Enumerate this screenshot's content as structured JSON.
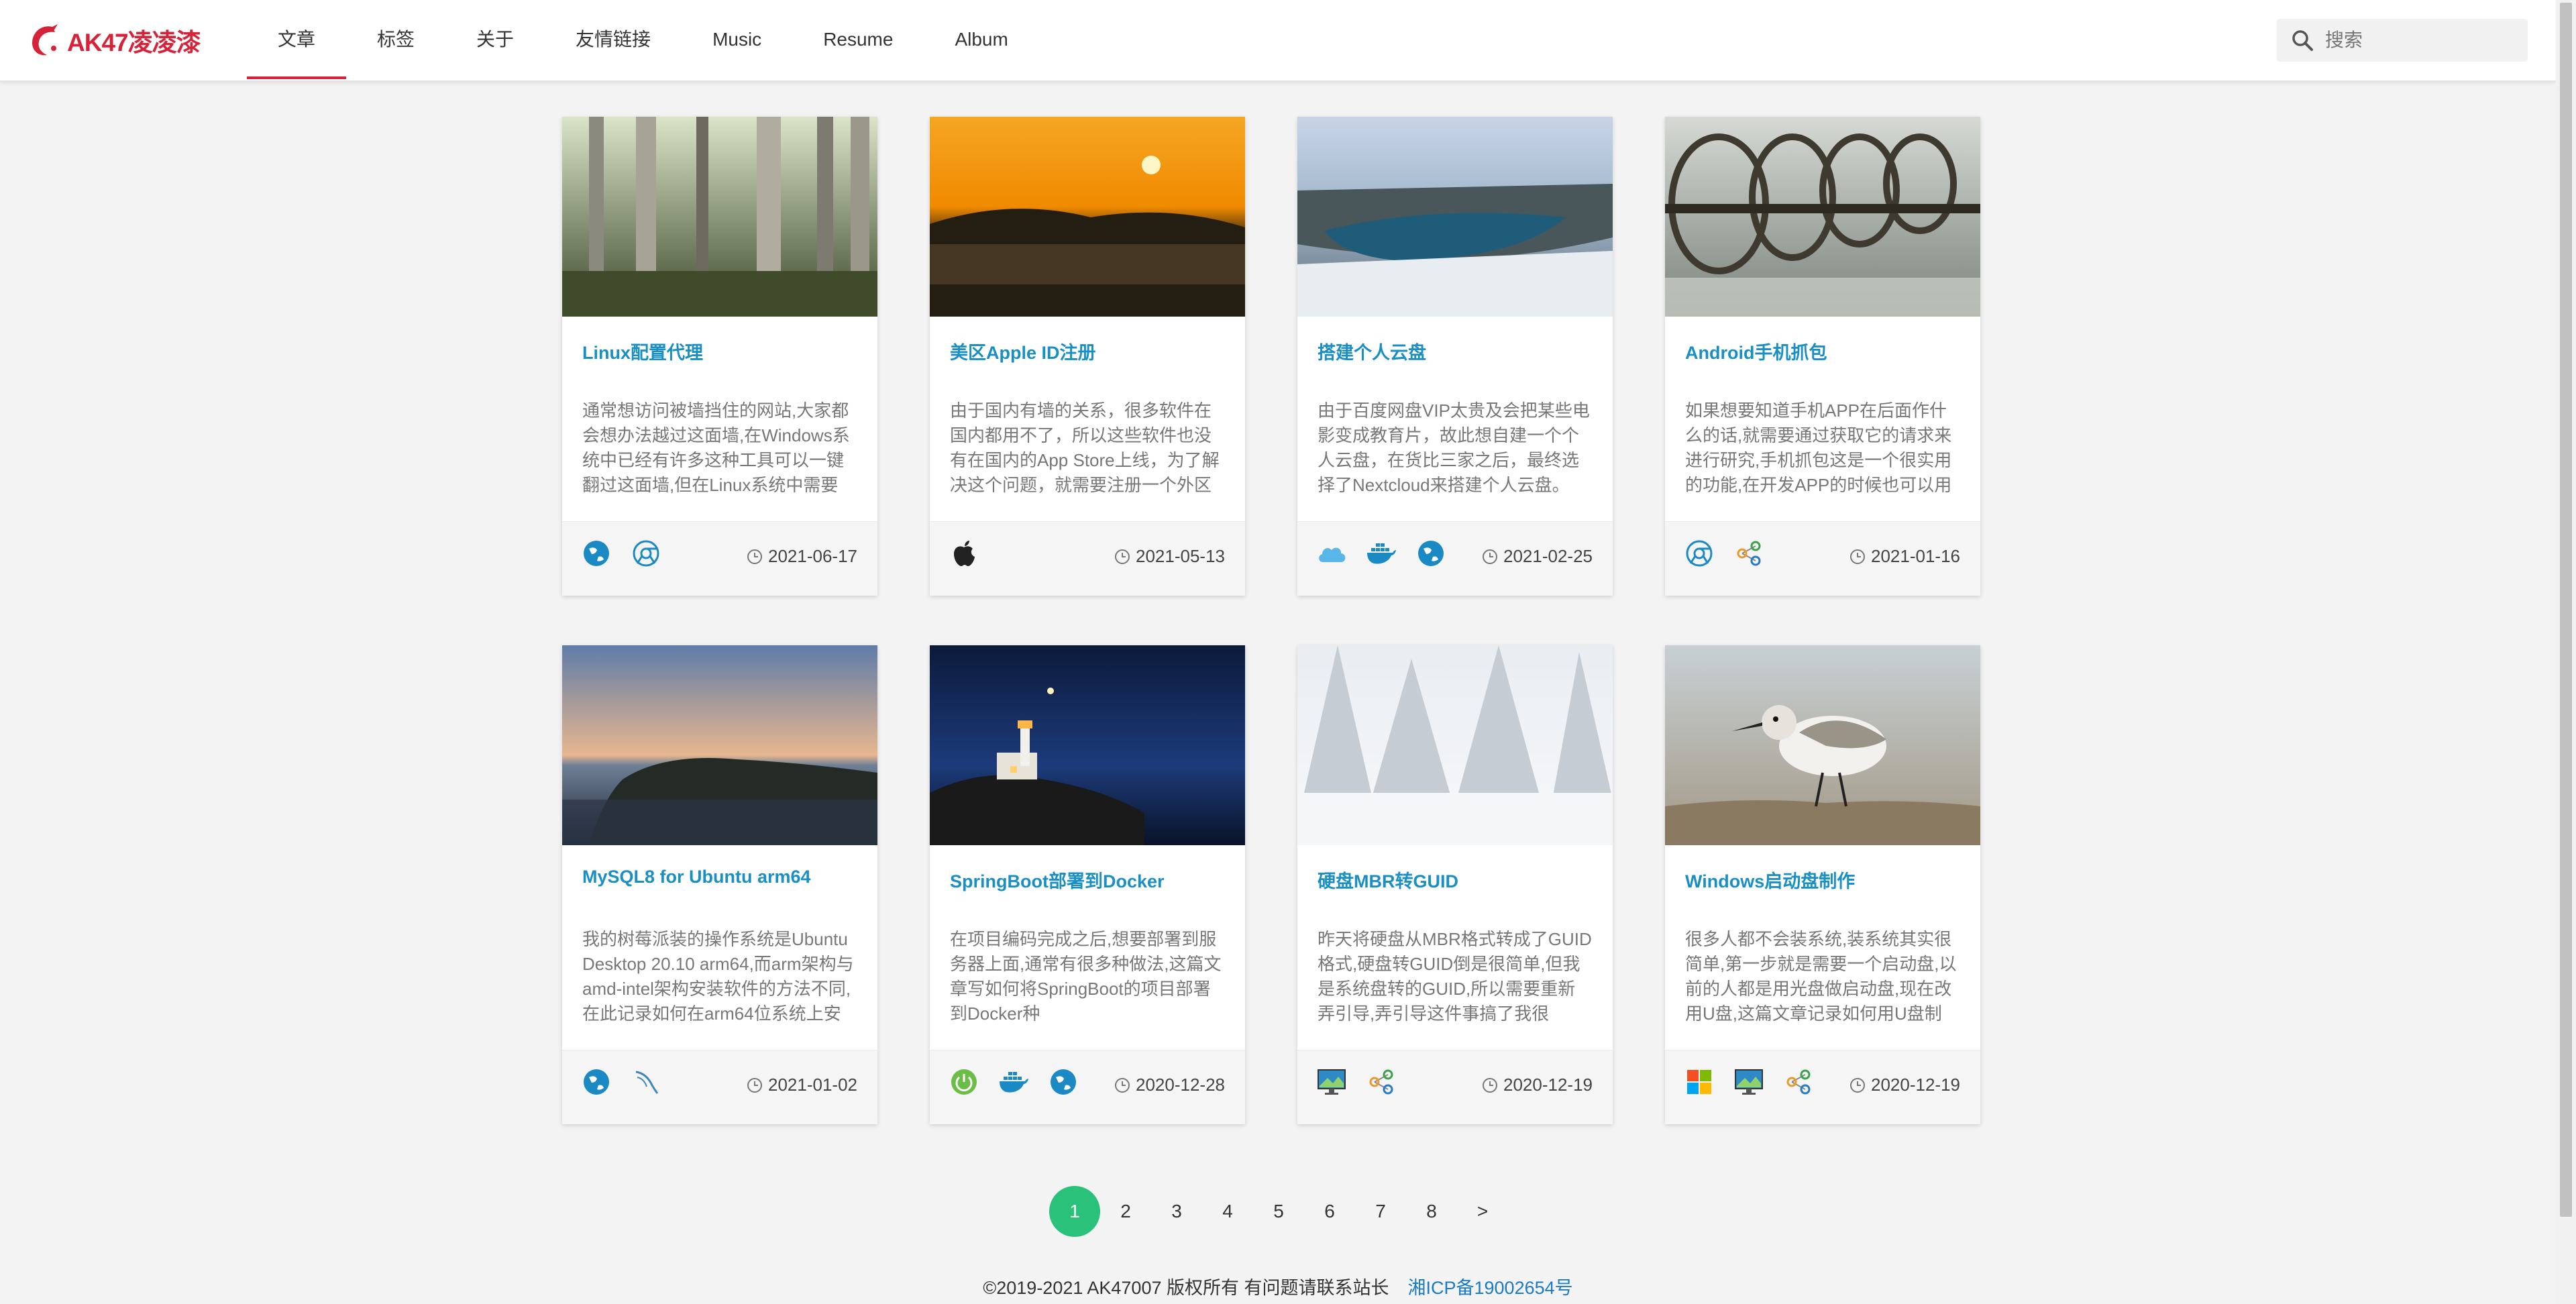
{
  "brand": {
    "name": "AK47凌凌漆",
    "color": "#d5233a"
  },
  "nav": {
    "items": [
      {
        "label": "文章",
        "active": true
      },
      {
        "label": "标签"
      },
      {
        "label": "关于"
      },
      {
        "label": "友情链接"
      },
      {
        "label": "Music"
      },
      {
        "label": "Resume"
      },
      {
        "label": "Album"
      }
    ]
  },
  "search": {
    "placeholder": "搜索",
    "icon": "search-icon"
  },
  "cards": [
    {
      "title": "Linux配置代理",
      "desc": "通常想访问被墙挡住的网站,大家都会想办法越过这面墙,在Windows系统中已经有许多这种工具可以一键翻过这面墙,但在Linux系统中需要",
      "date": "2021-06-17",
      "tags": [
        "globe-icon",
        "chrome-icon"
      ],
      "image": "forest-photo"
    },
    {
      "title": "美区Apple ID注册",
      "desc": "由于国内有墙的关系，很多软件在国内都用不了，所以这些软件也没有在国内的App Store上线，为了解决这个问题，就需要注册一个外区",
      "date": "2021-05-13",
      "tags": [
        "apple-icon"
      ],
      "image": "sunset-lake-photo"
    },
    {
      "title": "搭建个人云盘",
      "desc": "由于百度网盘VIP太贵及会把某些电影变成教育片，故此想自建一个个人云盘，在货比三家之后，最终选择了Nextcloud来搭建个人云盘。",
      "date": "2021-02-25",
      "tags": [
        "cloud-icon",
        "docker-icon",
        "globe-icon"
      ],
      "image": "river-canyon-photo"
    },
    {
      "title": "Android手机抓包",
      "desc": "如果想要知道手机APP在后面作什么的话,就需要通过获取它的请求来进行研究,手机抓包这是一个很实用的功能,在开发APP的时候也可以用",
      "date": "2021-01-16",
      "tags": [
        "chrome-icon",
        "share-icon"
      ],
      "image": "wheels-photo"
    },
    {
      "title": "MySQL8 for Ubuntu arm64",
      "desc": "我的树莓派装的操作系统是Ubuntu Desktop 20.10 arm64,而arm架构与amd-intel架构安装软件的方法不同,在此记录如何在arm64位系统上安",
      "date": "2021-01-02",
      "tags": [
        "globe-icon",
        "mysql-icon"
      ],
      "image": "coast-dusk-photo"
    },
    {
      "title": "SpringBoot部署到Docker",
      "desc": "在项目编码完成之后,想要部署到服务器上面,通常有很多种做法,这篇文章写如何将SpringBoot的项目部署到Docker种",
      "date": "2020-12-28",
      "tags": [
        "power-icon",
        "docker-icon",
        "globe-icon"
      ],
      "image": "lighthouse-photo"
    },
    {
      "title": "硬盘MBR转GUID",
      "desc": "昨天将硬盘从MBR格式转成了GUID格式,硬盘转GUID倒是很简单,但我是系统盘转的GUID,所以需要重新弄引导,弄引导这件事搞了我很",
      "date": "2020-12-19",
      "tags": [
        "monitor-icon",
        "share-icon"
      ],
      "image": "snow-trees-photo"
    },
    {
      "title": "Windows启动盘制作",
      "desc": "很多人都不会装系统,装系统其实很简单,第一步就是需要一个启动盘,以前的人都是用光盘做启动盘,现在改用U盘,这篇文章记录如何用U盘制",
      "date": "2020-12-19",
      "tags": [
        "windows-icon",
        "monitor-icon",
        "share-icon"
      ],
      "image": "sandpiper-photo"
    }
  ],
  "pagination": {
    "pages": [
      "1",
      "2",
      "3",
      "4",
      "5",
      "6",
      "7",
      "8",
      ">"
    ],
    "current": "1",
    "accent": "#2ac27a"
  },
  "footer": {
    "copyright": "©2019-2021 AK47007 版权所有 有问题请联系站长",
    "icp": "湘ICP备19002654号"
  }
}
